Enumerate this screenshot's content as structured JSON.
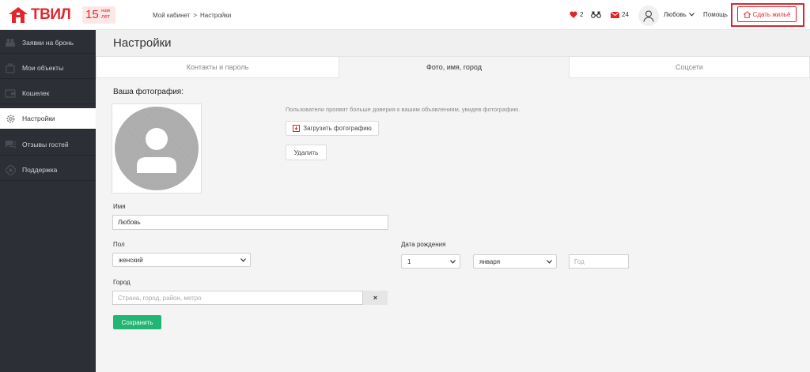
{
  "header": {
    "logo_text": "ТВИЛ",
    "anniversary_number": "15",
    "anniversary_line1": "нам",
    "anniversary_line2": "лет",
    "breadcrumb": {
      "home": "Мой кабинет",
      "separator": ">",
      "current": "Настройки"
    },
    "favorites_count": "2",
    "messages_count": "24",
    "user_name": "Любовь",
    "help_label": "Помощь",
    "cta_label": "Сдать жильё"
  },
  "sidebar": {
    "items": [
      {
        "label": "Заявки на бронь",
        "icon": "people-icon"
      },
      {
        "label": "Мои объекты",
        "icon": "suitcase-icon"
      },
      {
        "label": "Кошелек",
        "icon": "wallet-icon"
      },
      {
        "label": "Настройки",
        "icon": "gear-icon"
      },
      {
        "label": "Отзывы гостей",
        "icon": "chat-icon"
      },
      {
        "label": "Поддержка",
        "icon": "support-icon"
      }
    ],
    "active_index": 3
  },
  "main": {
    "title": "Настройки",
    "tabs": [
      {
        "label": "Контакты и пароль"
      },
      {
        "label": "Фото, имя, город"
      },
      {
        "label": "Соцсети"
      }
    ],
    "photo_section_title": "Ваша фотография:",
    "photo_hint": "Пользователи проявят больше доверия к вашим объявлениям, увидев фотографию.",
    "upload_label": "Загрузить фотографию",
    "delete_label": "Удалить",
    "name_label": "Имя",
    "name_value": "Любовь",
    "gender_label": "Пол",
    "gender_value": "женский",
    "birth_label": "Дата рождения",
    "birth_day": "1",
    "birth_month": "января",
    "birth_year_placeholder": "Год",
    "city_label": "Город",
    "city_placeholder": "Страна, город, район, метро",
    "clear_label": "×",
    "save_label": "Сохранить"
  },
  "colors": {
    "brand": "#e1262d",
    "sidebar_bg": "#2d2f36",
    "save": "#22b573"
  }
}
